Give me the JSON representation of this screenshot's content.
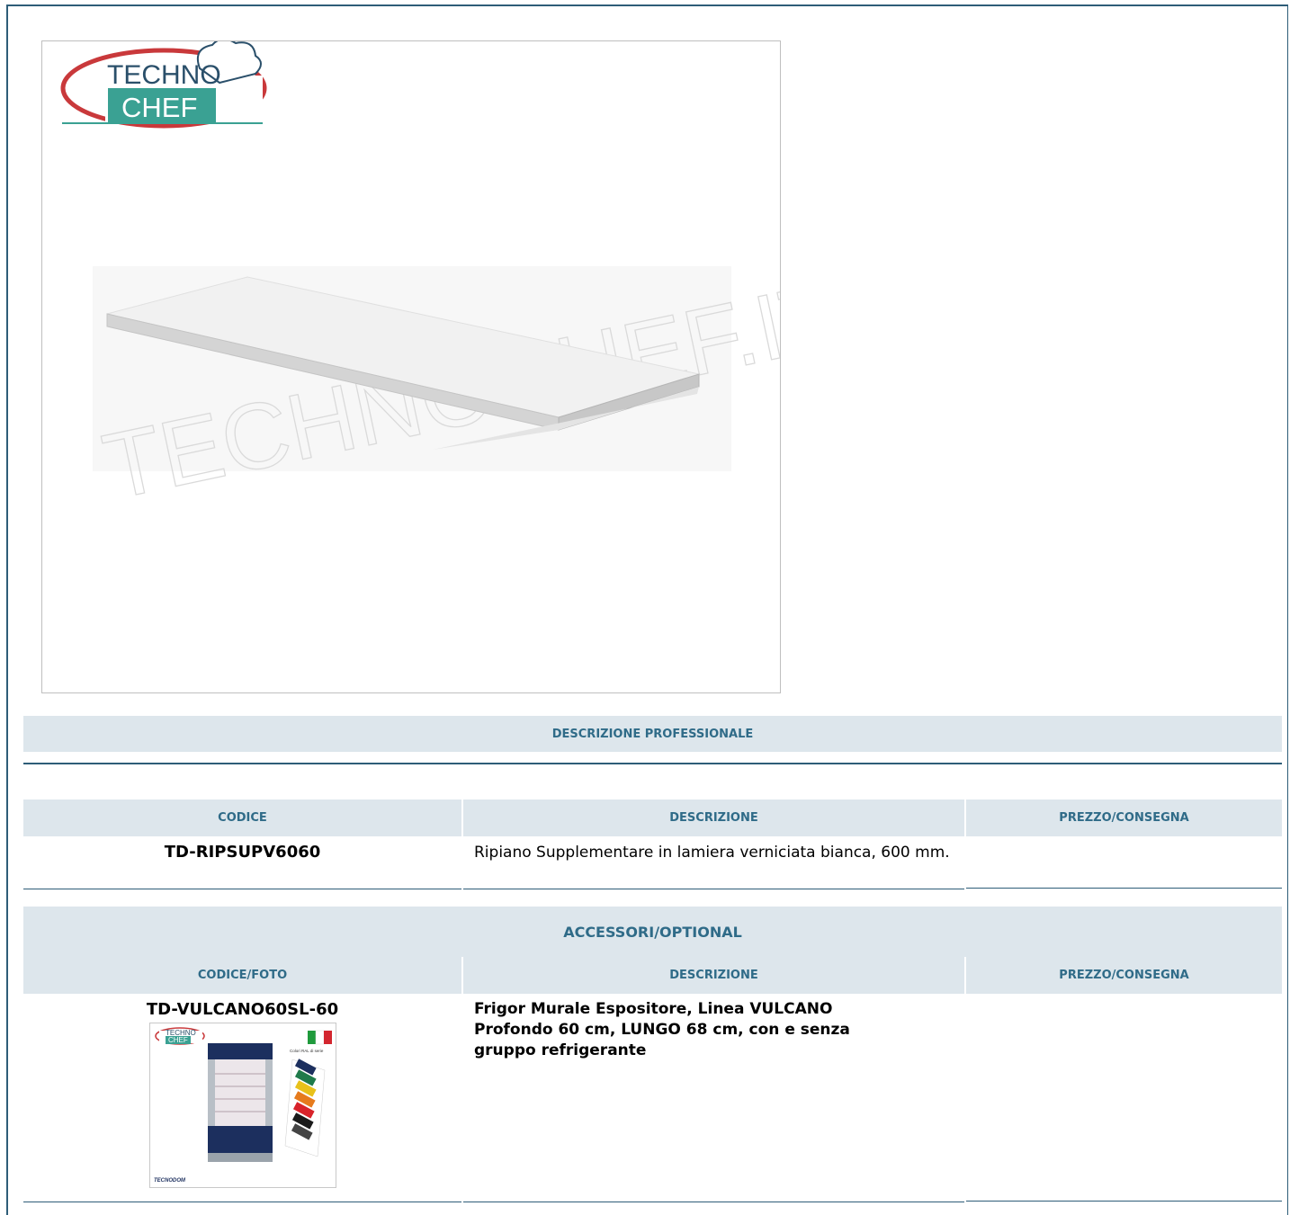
{
  "product_image": {
    "logo_top": "TECHNO",
    "logo_bottom": "CHEF",
    "watermark": "TECHNOCHEF.IT"
  },
  "section_professional": {
    "title": "DESCRIZIONE PROFESSIONALE"
  },
  "main_table": {
    "headers": [
      "CODICE",
      "DESCRIZIONE",
      "PREZZO/CONSEGNA"
    ],
    "row": {
      "code": "TD-RIPSUPV6060",
      "description": "Ripiano Supplementare in lamiera verniciata bianca, 600 mm.",
      "price": ""
    }
  },
  "accessories": {
    "title": "ACCESSORI/OPTIONAL",
    "headers": [
      "CODICE/FOTO",
      "DESCRIZIONE",
      "PREZZO/CONSEGNA"
    ],
    "row": {
      "code": "TD-VULCANO60SL-60",
      "description": "Frigor Murale Espositore, Linea VULCANO Profondo 60 cm, LUNGO 68 cm, con e senza gruppo refrigerante",
      "thumb_logo_top": "TECHNO",
      "thumb_logo_bottom": "CHEF",
      "thumb_caption": "Colori RAL di serie",
      "thumb_brand": "TECNODOM"
    }
  },
  "colors": {
    "frame": "#2e5d78",
    "header_bg": "#dde6ec",
    "header_text": "#2f6b88",
    "logo_red": "#c9393b",
    "logo_teal": "#3aa193"
  }
}
